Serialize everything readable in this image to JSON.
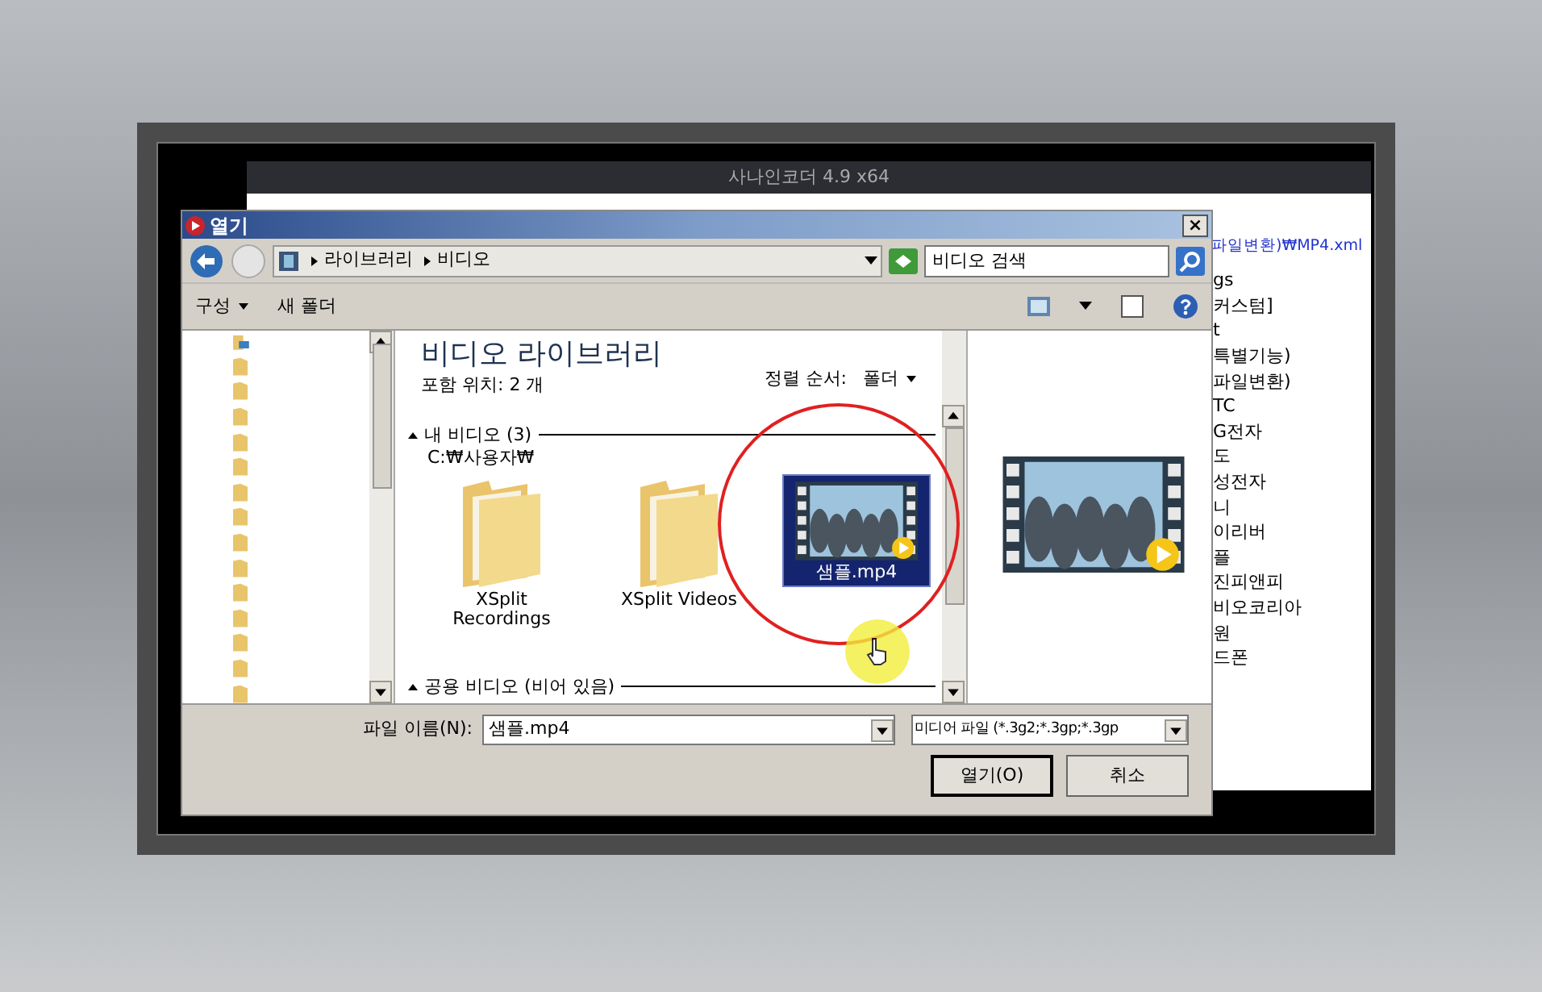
{
  "app_window": {
    "title": "사나인코더 4.9 x64",
    "path": "파일변환)₩MP4.xml",
    "list_items": [
      "gs",
      "커스텀]",
      "t",
      "특별기능)",
      "파일변환)",
      "TC",
      "G전자",
      "도",
      "성전자",
      "니",
      "이리버",
      "플",
      "진피앤피",
      "비오코리아",
      "원",
      "드폰"
    ]
  },
  "dialog": {
    "title": "열기",
    "close": "×",
    "breadcrumb": [
      "라이브러리",
      "비디오"
    ],
    "search": {
      "placeholder": "비디오 검색"
    },
    "toolbar": [
      {
        "label": "구성",
        "kind": "menu"
      },
      {
        "label": "새 폴더",
        "kind": "button"
      }
    ],
    "library": {
      "title": "비디오 라이브러리",
      "subtitle": "포함 위치: 2 개",
      "sort_label": "정렬 순서:",
      "sort_value": "폴더"
    },
    "groups": [
      {
        "title": "내 비디오 (3)",
        "path": "C:₩사용자₩",
        "expanded": true,
        "items": [
          {
            "name": "XSplit Recordings",
            "kind": "folder",
            "selected": false
          },
          {
            "name": "XSplit Videos",
            "kind": "folder",
            "selected": false
          },
          {
            "name": "샘플.mp4",
            "kind": "video",
            "selected": true
          }
        ]
      },
      {
        "title": "공용 비디오 (비어 있음)",
        "expanded": true
      }
    ],
    "file_name": {
      "label": "파일 이름(N):",
      "value": "샘플.mp4"
    },
    "file_type": "미디어 파일 (*.3g2;*.3gp;*.3gp",
    "buttons": [
      {
        "label": "열기(O)",
        "kind": "default"
      },
      {
        "label": "취소",
        "kind": "normal"
      }
    ]
  }
}
